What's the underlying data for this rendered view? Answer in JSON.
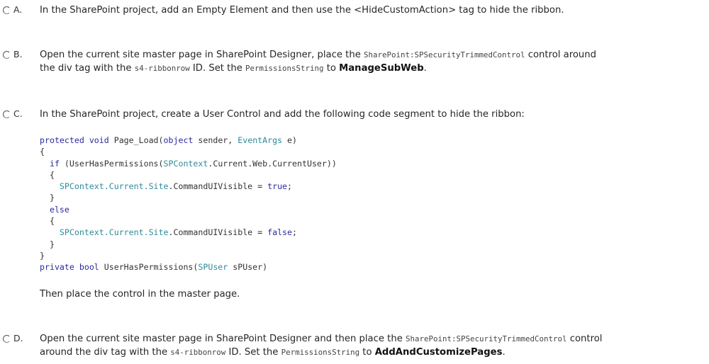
{
  "options": {
    "a": {
      "letter": "A.",
      "text": "In the SharePoint project, add an Empty Element and then use the <HideCustomAction> tag to hide the ribbon."
    },
    "b": {
      "letter": "B.",
      "line1_pre": "Open the current site master page in SharePoint Designer, place the ",
      "line1_code": "SharePoint:SPSecurityTrimmedControl",
      "line1_post": " control around",
      "line2_pre": "the div tag with the ",
      "line2_code1": "s4-ribbonrow",
      "line2_mid": " ID. Set the ",
      "line2_code2": "PermissionsString",
      "line2_to": " to ",
      "line2_bold": "ManageSubWeb",
      "line2_end": "."
    },
    "c": {
      "letter": "C.",
      "text": "In the SharePoint project, create a User Control and add the following code segment to hide the ribbon:",
      "code": {
        "l1_kw1": "protected",
        "l1_kw2": "void",
        "l1_name": "Page_Load(",
        "l1_kw3": "object",
        "l1_mid": " sender, ",
        "l1_type": "EventArgs",
        "l1_end": " e)",
        "l2": "{",
        "l3_kw": "if",
        "l3_pre": " (UserHasPermissions(",
        "l3_type": "SPContext",
        "l3_post": ".Current.Web.CurrentUser))",
        "l4": "{",
        "l5_type": "SPContext",
        "l5_mid": ".Current.Site",
        "l5_post": ".CommandUIVisible = ",
        "l5_kw": "true",
        "l5_end": ";",
        "l6": "}",
        "l7_kw": "else",
        "l8": "{",
        "l9_type": "SPContext",
        "l9_mid": ".Current.Site",
        "l9_post": ".CommandUIVisible = ",
        "l9_kw": "false",
        "l9_end": ";",
        "l10": "}",
        "l11": "}",
        "l12_kw1": "private",
        "l12_kw2": "bool",
        "l12_name": " UserHasPermissions(",
        "l12_type": "SPUser",
        "l12_end": " sPUser)"
      },
      "after": "Then place the control in the master page."
    },
    "d": {
      "letter": "D.",
      "line1_pre": "Open the current site master page in SharePoint Designer and then place the ",
      "line1_code": "SharePoint:SPSecurityTrimmedControl",
      "line1_post": " control",
      "line2_pre": "around the div tag with the ",
      "line2_code1": "s4-ribbonrow",
      "line2_mid": " ID. Set the ",
      "line2_code2": "PermissionsString",
      "line2_to": " to ",
      "line2_bold": "AddAndCustomizePages",
      "line2_end": "."
    }
  }
}
